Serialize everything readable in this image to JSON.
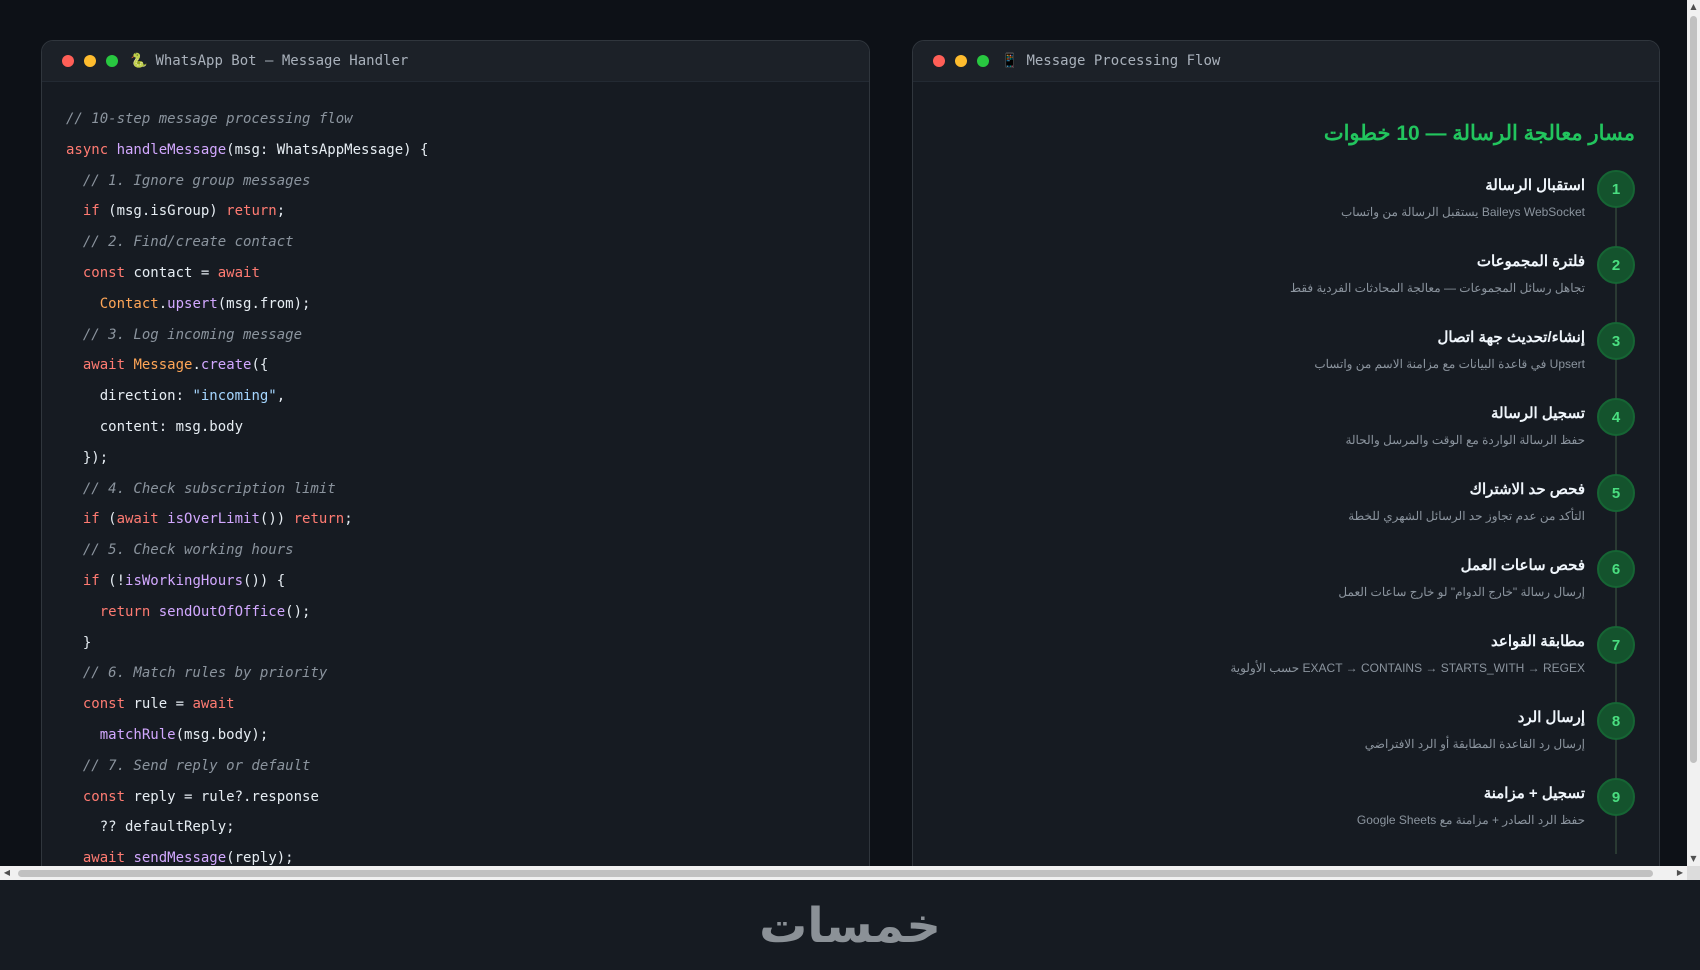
{
  "code_window": {
    "icon": "🐍",
    "title": "WhatsApp Bot — Message Handler",
    "lines": [
      [
        {
          "t": "// 10-step message processing flow",
          "c": "cmt"
        }
      ],
      [
        {
          "t": "async ",
          "c": "kw"
        },
        {
          "t": "handleMessage",
          "c": "fn"
        },
        {
          "t": "(msg: WhatsAppMessage) {",
          "c": ""
        }
      ],
      [
        {
          "t": "  // 1. Ignore group messages",
          "c": "cmt"
        }
      ],
      [
        {
          "t": "  ",
          "c": ""
        },
        {
          "t": "if",
          "c": "kw"
        },
        {
          "t": " (msg.isGroup) ",
          "c": ""
        },
        {
          "t": "return",
          "c": "kw"
        },
        {
          "t": ";",
          "c": ""
        }
      ],
      [
        {
          "t": "  // 2. Find/create contact",
          "c": "cmt"
        }
      ],
      [
        {
          "t": "  ",
          "c": ""
        },
        {
          "t": "const",
          "c": "kw"
        },
        {
          "t": " contact = ",
          "c": ""
        },
        {
          "t": "await",
          "c": "kw"
        }
      ],
      [
        {
          "t": "    ",
          "c": ""
        },
        {
          "t": "Contact",
          "c": "cls"
        },
        {
          "t": ".",
          "c": ""
        },
        {
          "t": "upsert",
          "c": "fn"
        },
        {
          "t": "(msg.from);",
          "c": ""
        }
      ],
      [
        {
          "t": "  // 3. Log incoming message",
          "c": "cmt"
        }
      ],
      [
        {
          "t": "  ",
          "c": ""
        },
        {
          "t": "await",
          "c": "kw"
        },
        {
          "t": " ",
          "c": ""
        },
        {
          "t": "Message",
          "c": "cls"
        },
        {
          "t": ".",
          "c": ""
        },
        {
          "t": "create",
          "c": "fn"
        },
        {
          "t": "({",
          "c": ""
        }
      ],
      [
        {
          "t": "    direction: ",
          "c": ""
        },
        {
          "t": "\"incoming\"",
          "c": "str"
        },
        {
          "t": ",",
          "c": ""
        }
      ],
      [
        {
          "t": "    content: msg.body",
          "c": ""
        }
      ],
      [
        {
          "t": "  });",
          "c": ""
        }
      ],
      [
        {
          "t": "  // 4. Check subscription limit",
          "c": "cmt"
        }
      ],
      [
        {
          "t": "  ",
          "c": ""
        },
        {
          "t": "if",
          "c": "kw"
        },
        {
          "t": " (",
          "c": ""
        },
        {
          "t": "await",
          "c": "kw"
        },
        {
          "t": " ",
          "c": ""
        },
        {
          "t": "isOverLimit",
          "c": "fn"
        },
        {
          "t": "()) ",
          "c": ""
        },
        {
          "t": "return",
          "c": "kw"
        },
        {
          "t": ";",
          "c": ""
        }
      ],
      [
        {
          "t": "  // 5. Check working hours",
          "c": "cmt"
        }
      ],
      [
        {
          "t": "  ",
          "c": ""
        },
        {
          "t": "if",
          "c": "kw"
        },
        {
          "t": " (!",
          "c": ""
        },
        {
          "t": "isWorkingHours",
          "c": "fn"
        },
        {
          "t": "()) {",
          "c": ""
        }
      ],
      [
        {
          "t": "    ",
          "c": ""
        },
        {
          "t": "return",
          "c": "kw"
        },
        {
          "t": " ",
          "c": ""
        },
        {
          "t": "sendOutOfOffice",
          "c": "fn"
        },
        {
          "t": "();",
          "c": ""
        }
      ],
      [
        {
          "t": "  }",
          "c": ""
        }
      ],
      [
        {
          "t": "  // 6. Match rules by priority",
          "c": "cmt"
        }
      ],
      [
        {
          "t": "  ",
          "c": ""
        },
        {
          "t": "const",
          "c": "kw"
        },
        {
          "t": " rule = ",
          "c": ""
        },
        {
          "t": "await",
          "c": "kw"
        }
      ],
      [
        {
          "t": "    ",
          "c": ""
        },
        {
          "t": "matchRule",
          "c": "fn"
        },
        {
          "t": "(msg.body);",
          "c": ""
        }
      ],
      [
        {
          "t": "  // 7. Send reply or default",
          "c": "cmt"
        }
      ],
      [
        {
          "t": "  ",
          "c": ""
        },
        {
          "t": "const",
          "c": "kw"
        },
        {
          "t": " reply = rule?.response",
          "c": ""
        }
      ],
      [
        {
          "t": "    ?? defaultReply;",
          "c": ""
        }
      ],
      [
        {
          "t": "  ",
          "c": ""
        },
        {
          "t": "await",
          "c": "kw"
        },
        {
          "t": " ",
          "c": ""
        },
        {
          "t": "sendMessage",
          "c": "fn"
        },
        {
          "t": "(reply);",
          "c": ""
        }
      ]
    ]
  },
  "flow_window": {
    "icon": "📱",
    "title": "Message Processing Flow",
    "heading": "مسار معالجة الرسالة — 10 خطوات",
    "steps": [
      {
        "num": "1",
        "title": "استقبال الرسالة",
        "desc": "Baileys WebSocket يستقبل الرسالة من واتساب"
      },
      {
        "num": "2",
        "title": "فلترة المجموعات",
        "desc": "تجاهل رسائل المجموعات — معالجة المحادثات الفردية فقط"
      },
      {
        "num": "3",
        "title": "إنشاء/تحديث جهة اتصال",
        "desc": "Upsert في قاعدة البيانات مع مزامنة الاسم من واتساب"
      },
      {
        "num": "4",
        "title": "تسجيل الرسالة",
        "desc": "حفظ الرسالة الواردة مع الوقت والمرسل والحالة"
      },
      {
        "num": "5",
        "title": "فحص حد الاشتراك",
        "desc": "التأكد من عدم تجاوز حد الرسائل الشهري للخطة"
      },
      {
        "num": "6",
        "title": "فحص ساعات العمل",
        "desc": "إرسال رسالة \"خارج الدوام\" لو خارج ساعات العمل"
      },
      {
        "num": "7",
        "title": "مطابقة القواعد",
        "desc": "EXACT → CONTAINS → STARTS_WITH → REGEX حسب الأولوية"
      },
      {
        "num": "8",
        "title": "إرسال الرد",
        "desc": "إرسال رد القاعدة المطابقة أو الرد الافتراضي"
      },
      {
        "num": "9",
        "title": "تسجيل + مزامنة",
        "desc": "حفظ الرد الصادر + مزامنة مع Google Sheets"
      }
    ]
  },
  "footer": {
    "logo": "خمسات"
  },
  "colors": {
    "accent": "#22c55e",
    "background": "#0d1117",
    "panel": "#161b22"
  }
}
